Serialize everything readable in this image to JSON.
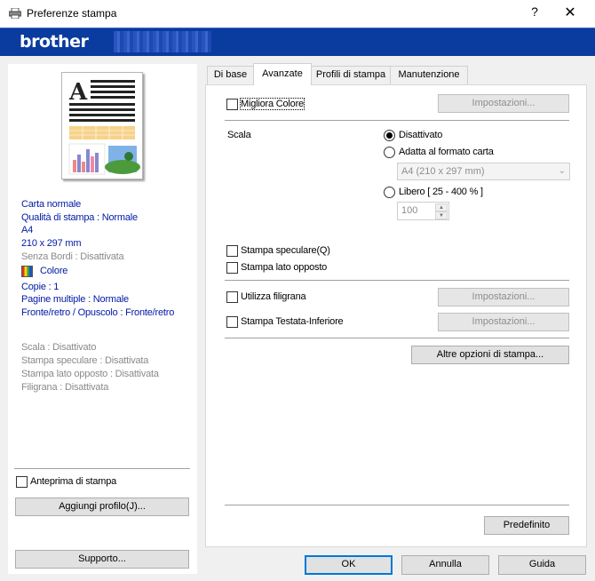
{
  "window": {
    "title": "Preferenze stampa",
    "help_glyph": "?",
    "close_glyph": "✕"
  },
  "brand": {
    "logo": "brother"
  },
  "preview": {
    "doc_letter": "A"
  },
  "summary": {
    "media": "Carta normale",
    "quality": "Qualità di stampa : Normale",
    "paper_size": "A4",
    "dimensions": "210 x 297 mm",
    "borderless": "Senza Bordi : Disattivata",
    "color_mode": "Colore",
    "copies": "Copie : 1",
    "multipage": "Pagine multiple : Normale",
    "duplex": "Fronte/retro / Opuscolo : Fronte/retro",
    "scale": "Scala : Disattivato",
    "mirror": "Stampa speculare : Disattivata",
    "reverse": "Stampa lato opposto : Disattivata",
    "watermark": "Filigrana : Disattivata"
  },
  "left_controls": {
    "preview_checkbox": "Anteprima di stampa",
    "add_profile": "Aggiungi profilo(J)...",
    "support": "Supporto..."
  },
  "tabs": [
    {
      "label": "Di base",
      "active": false
    },
    {
      "label": "Avanzate",
      "active": true
    },
    {
      "label": "Profili di stampa",
      "active": false
    },
    {
      "label": "Manutenzione",
      "active": false
    }
  ],
  "advanced": {
    "improve_color": "Migliora Colore",
    "settings_btn": "Impostazioni...",
    "scale_label": "Scala",
    "scale_off": "Disattivato",
    "fit_to_paper": "Adatta al formato carta",
    "paper_option": "A4 (210 x 297 mm)",
    "free": "Libero [ 25 - 400 % ]",
    "free_value": "100",
    "mirror_print": "Stampa speculare(Q)",
    "reverse_print": "Stampa lato opposto",
    "use_watermark": "Utilizza filigrana",
    "header_footer": "Stampa Testata-Inferiore",
    "other_options": "Altre opzioni di stampa...",
    "default_btn": "Predefinito"
  },
  "footer": {
    "ok": "OK",
    "cancel": "Annulla",
    "help": "Guida"
  },
  "colors": {
    "brand_bar": "#0a3b9e",
    "summary_text": "#0019a5",
    "summary_gray": "#8a8a8a",
    "focus": "#0078d7"
  }
}
